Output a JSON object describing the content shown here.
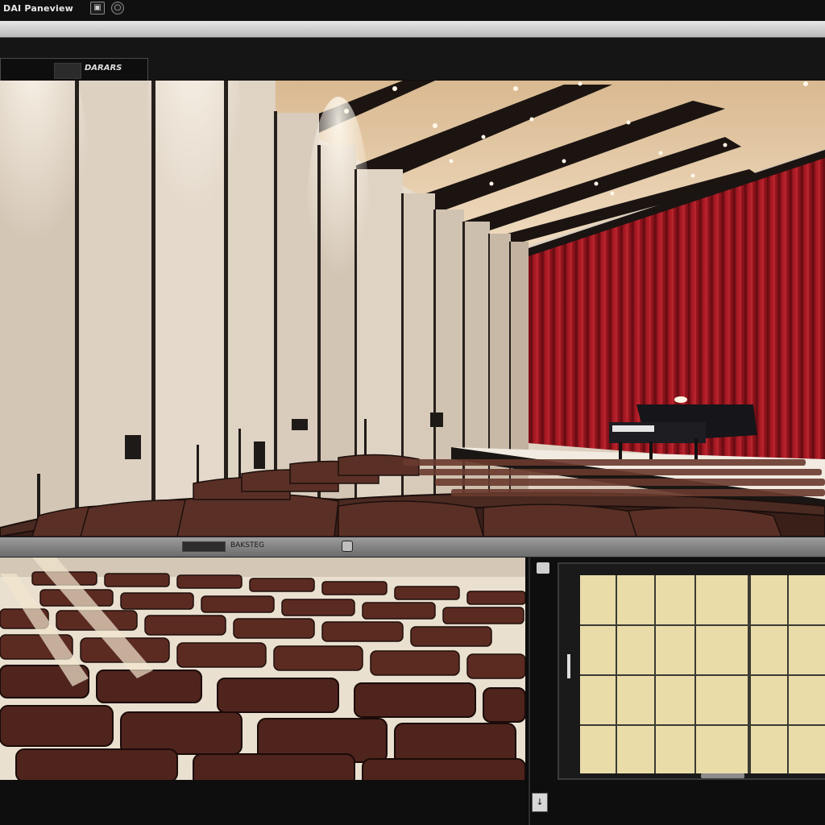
{
  "window": {
    "title": "DAI Paneview",
    "controls": {
      "restore_icon": "restore-icon",
      "settings_icon": "settings-icon"
    }
  },
  "viewer_tab": {
    "label": "DARARS"
  },
  "divider": {
    "label": "BAKSTEG"
  },
  "grid_panel": {
    "icon": "grid-icon",
    "bottom_icon_glyph": "↓"
  },
  "colors": {
    "curtain": "#9a1620",
    "wall": "#d9ccbd",
    "ceiling": "#e8cfae",
    "seat": "#5a2a20",
    "grid_cell": "#e9dca9",
    "chrome_dark": "#101010"
  }
}
